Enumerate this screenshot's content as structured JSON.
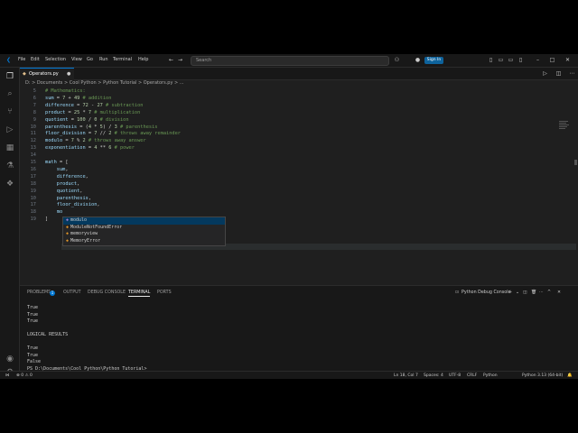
{
  "titlebar": {
    "menus": [
      "File",
      "Edit",
      "Selection",
      "View",
      "Go",
      "Run",
      "Terminal",
      "Help"
    ],
    "search_placeholder": "Search",
    "sign_in": "Sign In"
  },
  "tab": {
    "label": "Operators.py",
    "index": "1"
  },
  "breadcrumb": "D: > Documents > Cool Python > Python Tutorial > Operators.py > ...",
  "code_lines": [
    {
      "n": "5",
      "t": "# Mathematics:"
    },
    {
      "n": "6",
      "t": "sum = 7 + 49 # addition"
    },
    {
      "n": "7",
      "t": "difference = 72 - 27 # subtraction"
    },
    {
      "n": "8",
      "t": "product = 25 * 7 # multiplication"
    },
    {
      "n": "9",
      "t": "quotient = 100 / 0 # division"
    },
    {
      "n": "10",
      "t": "parenthesis = (4 * 5) / 3 # parenthesis"
    },
    {
      "n": "11",
      "t": "floor_division = 7 // 2 # throws away remainder"
    },
    {
      "n": "12",
      "t": "modulo = 7 % 2 # throws away answer"
    },
    {
      "n": "13",
      "t": "exponentiation = 4 ** 6 # power"
    },
    {
      "n": "14",
      "t": ""
    },
    {
      "n": "15",
      "t": "math = ["
    },
    {
      "n": "16",
      "t": "    sum,"
    },
    {
      "n": "17",
      "t": "    difference,"
    },
    {
      "n": "18",
      "t": "    product,"
    },
    {
      "n": "19",
      "t": "    quotient,"
    },
    {
      "n": "10",
      "t": "    parenthesis,"
    },
    {
      "n": "17",
      "t": "    floor_division,"
    },
    {
      "n": "18",
      "t": "    mo"
    },
    {
      "n": "19",
      "t": "]"
    }
  ],
  "suggestions": [
    "modulo",
    "ModuleNotFoundError",
    "memoryview",
    "MemoryError"
  ],
  "panel": {
    "tabs": [
      "PROBLEMS",
      "OUTPUT",
      "DEBUG CONSOLE",
      "TERMINAL",
      "PORTS"
    ],
    "problems_count": "1",
    "terminal_name": "Python Debug Console",
    "terminal_lines": [
      "True",
      "True",
      "True",
      "",
      "LOGICAL RESULTS",
      "",
      "True",
      "True",
      "False",
      "PS D:\\Documents\\Cool Python\\Python Tutorial> "
    ]
  },
  "status": {
    "errors": "⊗ 0 ⚠ 0",
    "position": "Ln 18, Col 7",
    "spaces": "Spaces: 4",
    "encoding": "UTF-8",
    "eol": "CRLF",
    "language": "Python",
    "interpreter": "Python 3.13 (64-bit)"
  },
  "colors": {
    "accent": "#0078d4",
    "background": "#1f1f1f"
  }
}
